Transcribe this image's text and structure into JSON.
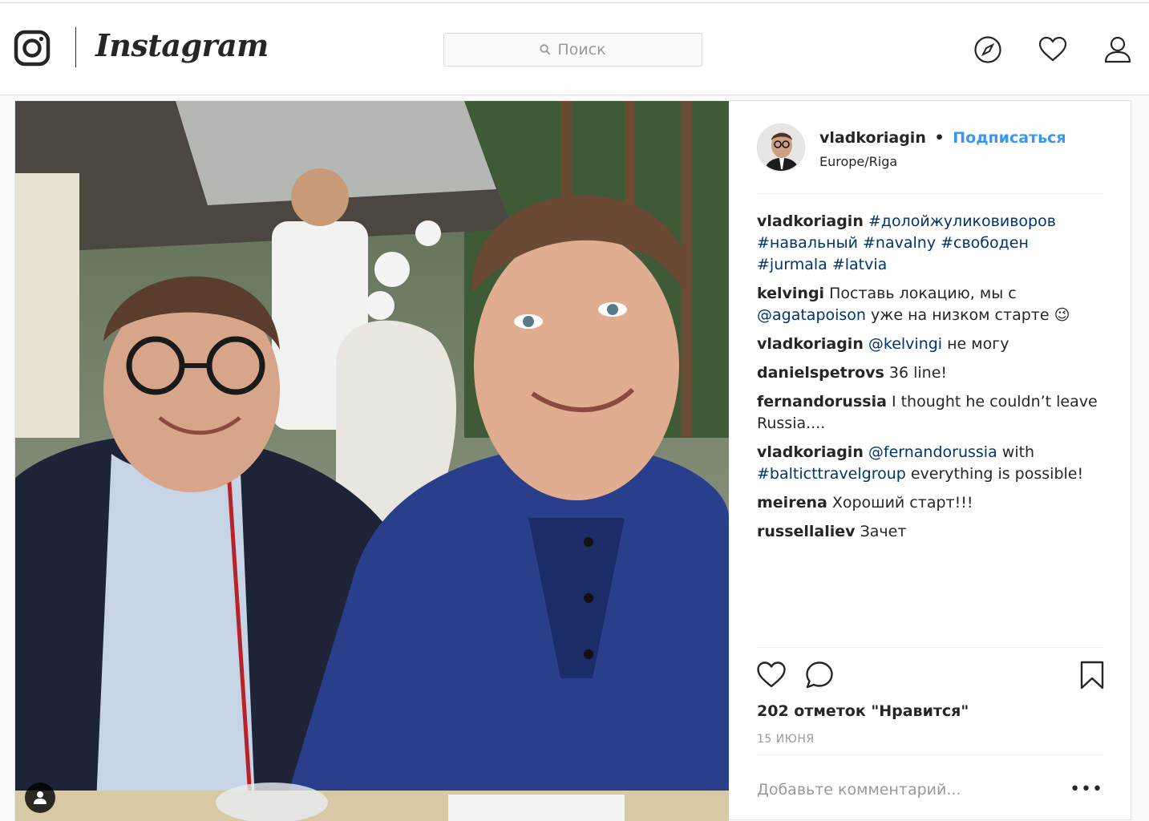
{
  "header": {
    "wordmark": "Instagram",
    "search_placeholder": "Поиск",
    "icons": [
      "instagram-glyph-icon",
      "compass-icon",
      "heart-icon",
      "profile-icon"
    ]
  },
  "post": {
    "author": {
      "username": "vladkoriagin",
      "separator": "•",
      "follow_label": "Подписаться",
      "location": "Europe/Riga"
    },
    "comments": [
      {
        "user": "vladkoriagin",
        "parts": [
          {
            "t": "#долойжуликовиворов",
            "tag": true
          },
          {
            "t": " "
          },
          {
            "t": "#навальный",
            "tag": true
          },
          {
            "t": " "
          },
          {
            "t": "#navalny",
            "tag": true
          },
          {
            "t": " "
          },
          {
            "t": "#свободен",
            "tag": true
          },
          {
            "t": " "
          },
          {
            "t": "#jurmala",
            "tag": true
          },
          {
            "t": " "
          },
          {
            "t": "#latvia",
            "tag": true
          }
        ]
      },
      {
        "user": "kelvingi",
        "parts": [
          {
            "t": "Поставь локацию, мы с "
          },
          {
            "t": "@agatapoison",
            "tag": true
          },
          {
            "t": " уже на низком старте 😉"
          }
        ]
      },
      {
        "user": "vladkoriagin",
        "parts": [
          {
            "t": "@kelvingi",
            "tag": true
          },
          {
            "t": " не могу"
          }
        ]
      },
      {
        "user": "danielspetrovs",
        "parts": [
          {
            "t": "36 line!"
          }
        ]
      },
      {
        "user": "fernandorussia",
        "parts": [
          {
            "t": "I thought he couldn’t leave Russia...."
          }
        ]
      },
      {
        "user": "vladkoriagin",
        "parts": [
          {
            "t": "@fernandorussia",
            "tag": true
          },
          {
            "t": " with "
          },
          {
            "t": "#balticttravelgroup",
            "tag": true
          },
          {
            "t": " everything is possible!"
          }
        ]
      },
      {
        "user": "meirena",
        "parts": [
          {
            "t": "Хороший старт!!!"
          }
        ]
      },
      {
        "user": "russellaliev",
        "parts": [
          {
            "t": "Зачет"
          }
        ]
      }
    ],
    "likes_label": "202 отметок \"Нравится\"",
    "date": "15 ИЮНЯ",
    "add_comment_placeholder": "Добавьте комментарий...",
    "more_label": "•••",
    "colors": {
      "link": "#003569",
      "follow": "#3897f0",
      "muted": "#999999"
    }
  }
}
